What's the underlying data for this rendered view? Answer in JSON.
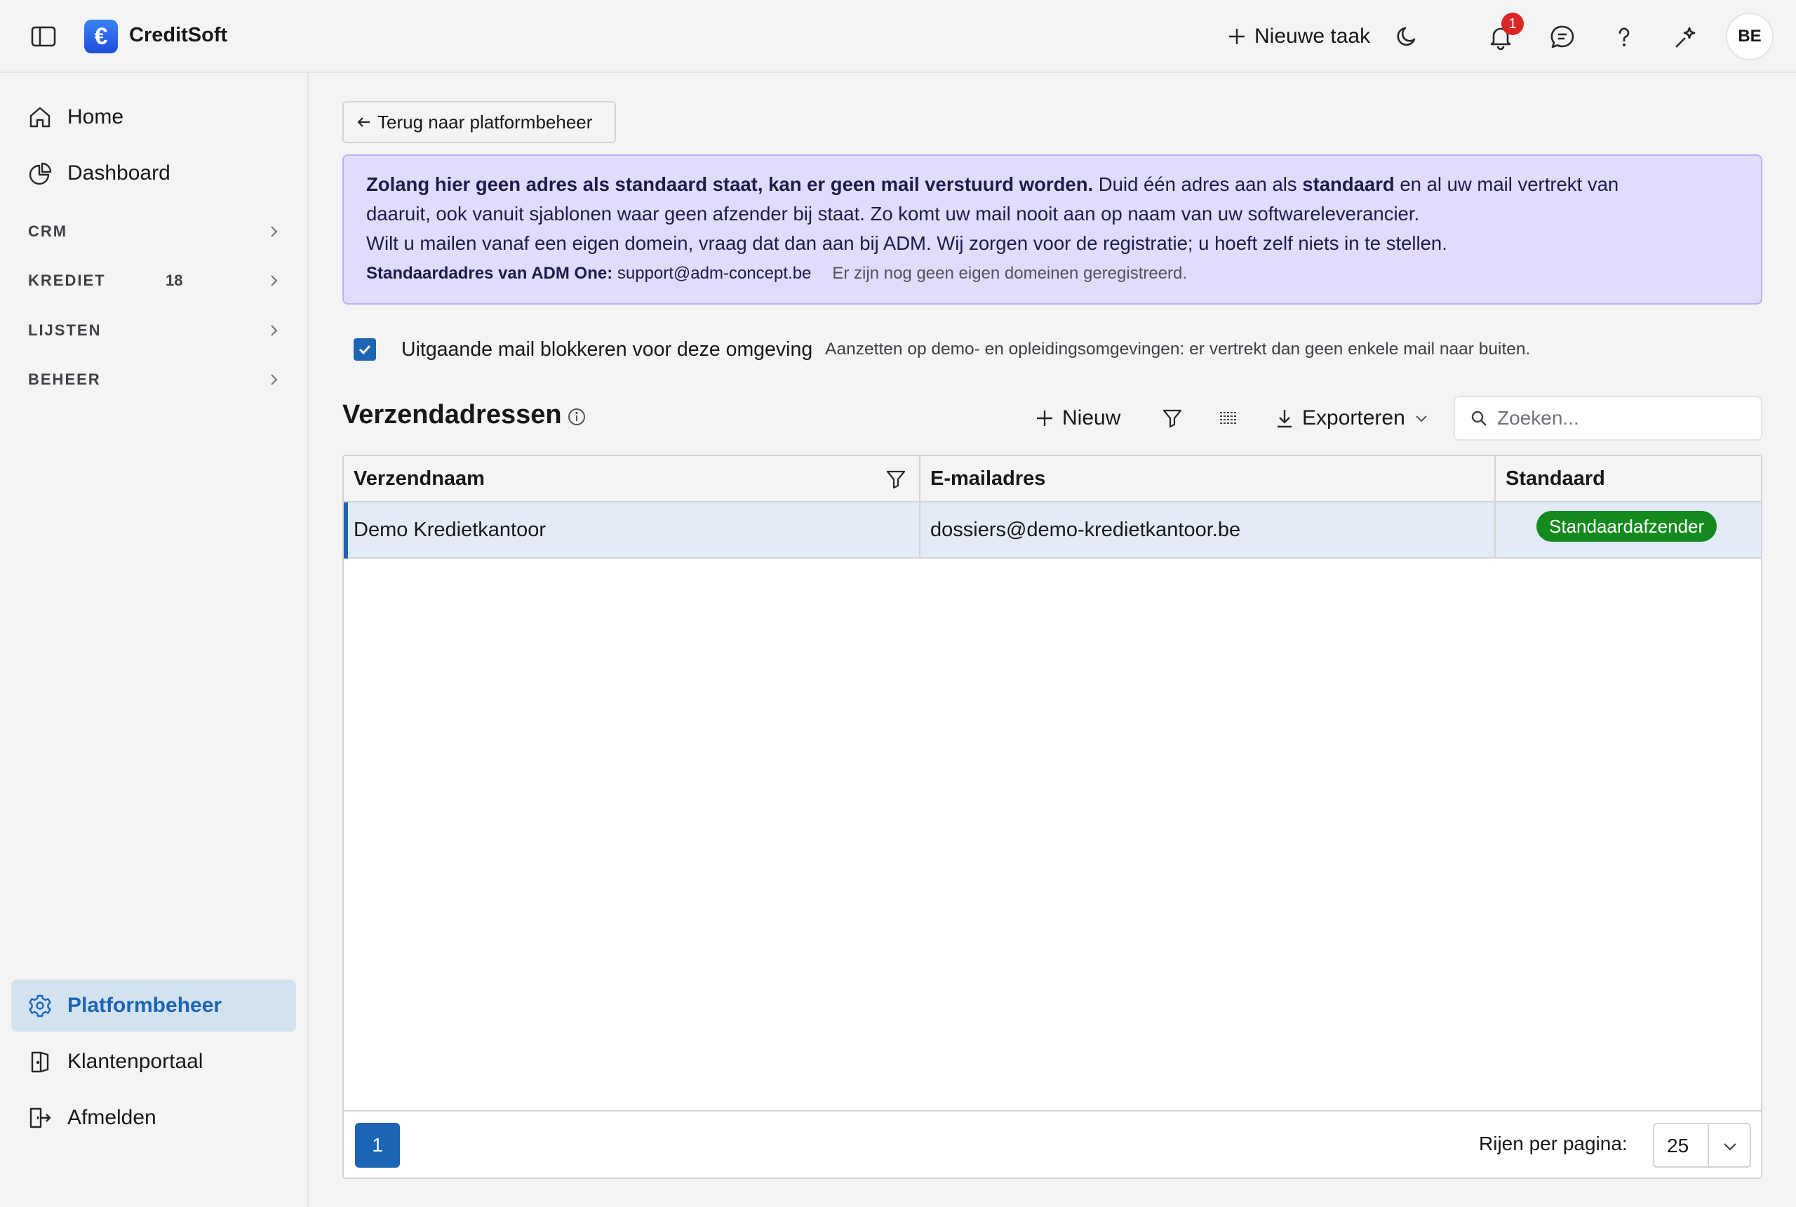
{
  "app": {
    "name": "CreditSoft",
    "logo_glyph": "€",
    "new_task_label": "Nieuwe taak",
    "notification_count": "1",
    "user_initials": "BE"
  },
  "sidebar": {
    "home": "Home",
    "dashboard": "Dashboard",
    "groups": [
      {
        "label": "CRM",
        "count": ""
      },
      {
        "label": "KREDIET",
        "count": "18"
      },
      {
        "label": "LIJSTEN",
        "count": ""
      },
      {
        "label": "BEHEER",
        "count": ""
      }
    ],
    "bottom": [
      {
        "label": "Platformbeheer",
        "active": true
      },
      {
        "label": "Klantenportaal",
        "active": false
      },
      {
        "label": "Afmelden",
        "active": false
      }
    ]
  },
  "main": {
    "back_label": "Terug naar platformbeheer",
    "info": {
      "line1_bold": "Zolang hier geen adres als standaard staat, kan er geen mail verstuurd worden.",
      "line1_a": " Duid één adres aan als ",
      "line1_bold2": "standaard",
      "line1_b": " en al uw mail vertrekt van",
      "line2": "daaruit, ook vanuit sjablonen waar geen afzender bij staat. Zo komt uw mail nooit aan op naam van uw softwareleverancier.",
      "line3": "Wilt u mailen vanaf een eigen domein, vraag dat dan aan bij ADM. Wij zorgen voor de registratie; u hoeft zelf niets in te stellen.",
      "default_label": "Standaardadres van ADM One:",
      "default_value": " support@adm-concept.be",
      "no_domains": "Er zijn nog geen eigen domeinen geregistreerd."
    },
    "block_mail": {
      "label": "Uitgaande mail blokkeren voor deze omgeving",
      "hint": "Aanzetten op demo- en opleidingsomgevingen: er vertrekt dan geen enkele mail naar buiten.",
      "checked": true
    },
    "section_title": "Verzendadressen",
    "toolbar": {
      "new_label": "Nieuw",
      "export_label": "Exporteren",
      "search_placeholder": "Zoeken..."
    },
    "table": {
      "columns": [
        "Verzendnaam",
        "E-mailadres",
        "Standaard"
      ],
      "rows": [
        {
          "name": "Demo Kredietkantoor",
          "email": "dossiers@demo-kredietkantoor.be",
          "badge": "Standaardafzender"
        }
      ]
    },
    "pagination": {
      "current_page": "1",
      "rows_label": "Rijen per pagina:",
      "rows_value": "25"
    }
  },
  "colors": {
    "accent": "#1c64b4",
    "info_bg": "#e0dcfb",
    "badge_green": "#148a1e",
    "notif_red": "#dc2626"
  }
}
